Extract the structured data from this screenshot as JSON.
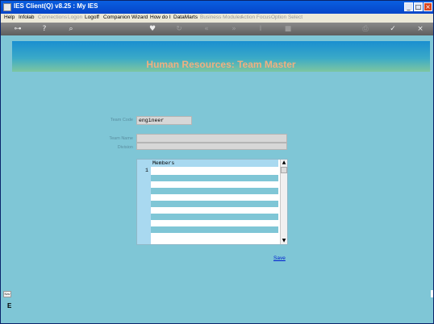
{
  "window": {
    "title": "IES Client(Q) v8.25 : My IES"
  },
  "menu": {
    "items": [
      {
        "label": "Help",
        "enabled": true
      },
      {
        "label": "Infolab",
        "enabled": true
      },
      {
        "label": "Connections",
        "enabled": false
      },
      {
        "label": "Logon",
        "enabled": false
      },
      {
        "label": "Logoff",
        "enabled": true
      },
      {
        "label": "Companion",
        "enabled": true
      },
      {
        "label": "Wizard",
        "enabled": true
      },
      {
        "label": "How do I",
        "enabled": true
      },
      {
        "label": "DataMarts",
        "enabled": true
      },
      {
        "label": "Business Modules",
        "enabled": false
      },
      {
        "label": "Action Focus",
        "enabled": false
      },
      {
        "label": "Option Select",
        "enabled": false
      }
    ]
  },
  "toolbar": {
    "icons": [
      "key-icon",
      "help-icon",
      "search-icon",
      "heart-icon",
      "refresh-icon",
      "rewind-icon",
      "fast-forward-icon",
      "text-cursor-icon",
      "stop-icon",
      "print-icon",
      "check-icon",
      "close-icon"
    ]
  },
  "page": {
    "title": "Human Resources: Team Master"
  },
  "form": {
    "team_code_label": "Team Code",
    "team_code_value": "engineer",
    "team_name_label": "Team Name",
    "team_name_value": "",
    "division_label": "Division",
    "division_value": ""
  },
  "members": {
    "column_header": "Members",
    "row_number": "1"
  },
  "actions": {
    "save_label": "Save"
  },
  "side": {
    "widget_text": "Nav",
    "letter": "E"
  }
}
